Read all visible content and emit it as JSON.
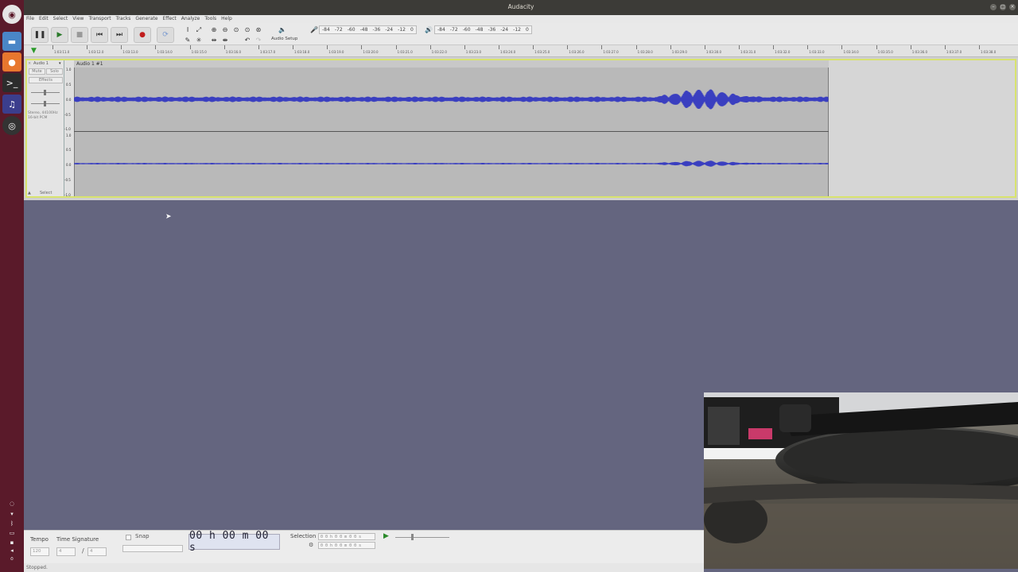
{
  "window": {
    "title": "Audacity"
  },
  "menu": [
    "File",
    "Edit",
    "Select",
    "View",
    "Transport",
    "Tracks",
    "Generate",
    "Effect",
    "Analyze",
    "Tools",
    "Help"
  ],
  "toolbar": {
    "audio_setup_label": "Audio Setup",
    "record_meter_ticks": [
      "-84",
      "-72",
      "-60",
      "-48",
      "-36",
      "-24",
      "-12",
      "0"
    ],
    "play_meter_ticks": [
      "-84",
      "-72",
      "-60",
      "-48",
      "-36",
      "-24",
      "-12",
      "0"
    ]
  },
  "ruler": {
    "ticks": [
      "1:03:11.0",
      "1:03:12.0",
      "1:03:13.0",
      "1:03:14.0",
      "1:03:15.0",
      "1:03:16.0",
      "1:03:17.0",
      "1:03:18.0",
      "1:03:19.0",
      "1:03:20.0",
      "1:03:21.0",
      "1:03:22.0",
      "1:03:23.0",
      "1:03:24.0",
      "1:03:25.0",
      "1:03:26.0",
      "1:03:27.0",
      "1:03:28.0",
      "1:03:29.0",
      "1:03:30.0",
      "1:03:31.0",
      "1:03:32.0",
      "1:03:33.0",
      "1:03:34.0",
      "1:03:35.0",
      "1:03:36.0",
      "1:03:37.0",
      "1:03:38.0"
    ]
  },
  "track": {
    "name": "Audio 1",
    "clip_name": "Audio 1 #1",
    "mute_label": "Mute",
    "solo_label": "Solo",
    "effects_label": "Effects",
    "info": "Stereo, 44100Hz\n16-bit PCM",
    "select_label": "Select",
    "vruler_top": [
      "1.0",
      "0.5",
      "0.0",
      "-0.5",
      "-1.0"
    ],
    "vruler_bottom": [
      "1.0",
      "0.5",
      "0.0",
      "-0.5",
      "-1.0"
    ]
  },
  "bottom": {
    "tempo_label": "Tempo",
    "tempo_value": "120",
    "time_signature_label": "Time Signature",
    "ts_num": "4",
    "ts_den": "4",
    "snap_label": "Snap",
    "time_display": "00 h 00 m 00 s",
    "selection_label": "Selection",
    "sel_start": "0 0 h 0 0 m 0 0 s",
    "sel_end": "0 0 h 0 0 m 0 0 s"
  },
  "status": {
    "text": "Stopped."
  },
  "colors": {
    "waveform": "#3a3fc0",
    "clip_bg": "#b9b9b9",
    "track_highlight": "#d8e36e",
    "launcher": "#5a1a2a",
    "background": "#64657f"
  }
}
